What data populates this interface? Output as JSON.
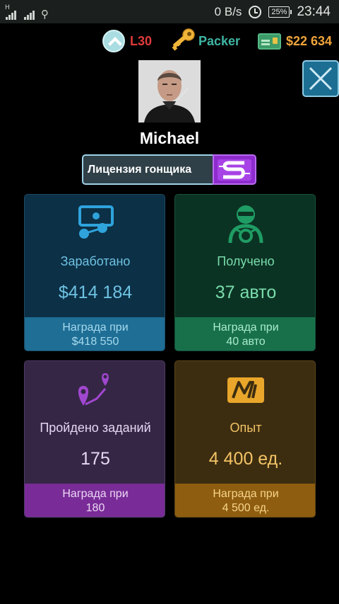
{
  "status_bar": {
    "signal1_label": "H",
    "signal2_label": "ııl",
    "network_speed": "0 B/s",
    "battery": "25%",
    "time": "23:44"
  },
  "hud": {
    "level": "L30",
    "rank": "Packer",
    "money": "$22 634"
  },
  "profile": {
    "name": "Michael",
    "license_label": "Лицензия гонщика",
    "license_grade": "S"
  },
  "cards": [
    {
      "title": "Заработано",
      "value": "$414 184",
      "reward_line1": "Награда при",
      "reward_line2": "$418 550"
    },
    {
      "title": "Получено",
      "value": "37 авто",
      "reward_line1": "Награда при",
      "reward_line2": "40 авто"
    },
    {
      "title": "Пройдено заданий",
      "value": "175",
      "reward_line1": "Награда при",
      "reward_line2": "180"
    },
    {
      "title": "Опыт",
      "value": "4 400 ед.",
      "reward_line1": "Награда при",
      "reward_line2": "4 500 ед."
    }
  ],
  "colors": {
    "level_text": "#e03b3b",
    "rank_text": "#3fb6a4",
    "money_text": "#f0a43a",
    "earned_accent": "#6ec2e2",
    "cars_accent": "#79dcad",
    "missions_accent": "#9b3cc4",
    "xp_accent": "#f3c366"
  },
  "icons": {
    "level": "chevron-up-circle-icon",
    "rank": "key-icon",
    "money": "banknote-icon",
    "close": "close-icon",
    "earned": "money-network-icon",
    "cars": "driver-helmet-icon",
    "missions": "route-pins-icon",
    "xp": "xp-logo-icon"
  }
}
